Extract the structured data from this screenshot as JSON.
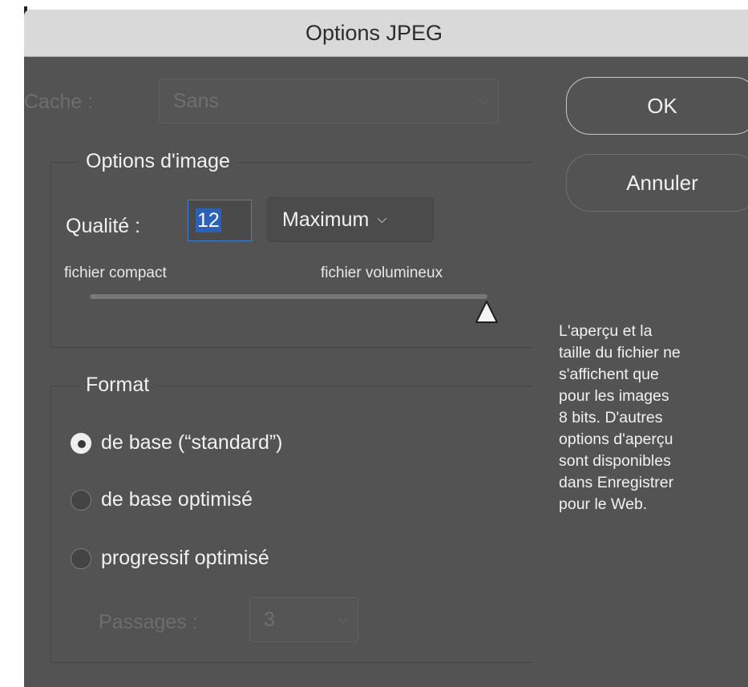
{
  "window": {
    "title": "Options JPEG"
  },
  "matte": {
    "label": "Cache :",
    "value": "Sans"
  },
  "image_options": {
    "title": "Options d'image",
    "quality_label": "Qualité :",
    "quality_value": "12",
    "quality_preset": "Maximum",
    "slider_left_label": "fichier compact",
    "slider_right_label": "fichier volumineux",
    "slider_level": 1.0
  },
  "format": {
    "title": "Format",
    "options": [
      {
        "label": "de base  (“standard”)",
        "selected": true
      },
      {
        "label": "de base optimisé",
        "selected": false
      },
      {
        "label": "progressif optimisé",
        "selected": false
      }
    ],
    "scans_label": "Passages :",
    "scans_value": "3"
  },
  "buttons": {
    "ok": "OK",
    "cancel": "Annuler"
  },
  "info_text": [
    "L'aperçu et la",
    "taille du fichier ne",
    "s'affichent que",
    "pour les images",
    "8 bits. D'autres",
    "options d'aperçu",
    "sont disponibles",
    "dans Enregistrer",
    "pour le Web."
  ]
}
